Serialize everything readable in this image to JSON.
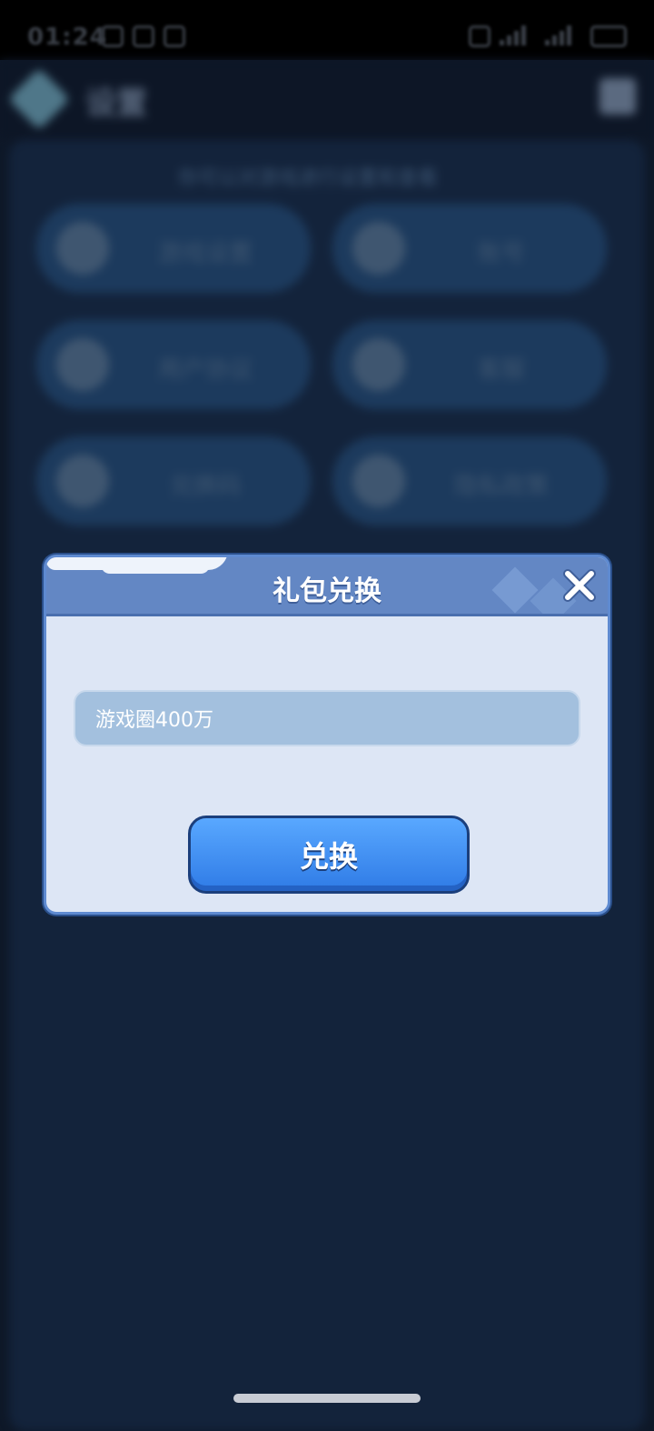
{
  "status_bar": {
    "time": "01:24"
  },
  "background": {
    "title": "设置",
    "subtitle": "你可以对游戏进行设置和查看",
    "tiles": [
      {
        "label": "游戏设置"
      },
      {
        "label": "账号"
      },
      {
        "label": "用户协议"
      },
      {
        "label": "客服"
      },
      {
        "label": "兑换码"
      },
      {
        "label": "隐私政策"
      }
    ]
  },
  "dialog": {
    "title": "礼包兑换",
    "input_value": "游戏圈400万",
    "button_label": "兑换"
  },
  "colors": {
    "page_bg": "#0e1828",
    "dialog_bg": "#dde6f5",
    "dialog_header": "#6387c4",
    "input_bg": "#a3c0de",
    "button": "#3d8ff5"
  },
  "icons": [
    "close-icon",
    "settings-logo-icon"
  ]
}
